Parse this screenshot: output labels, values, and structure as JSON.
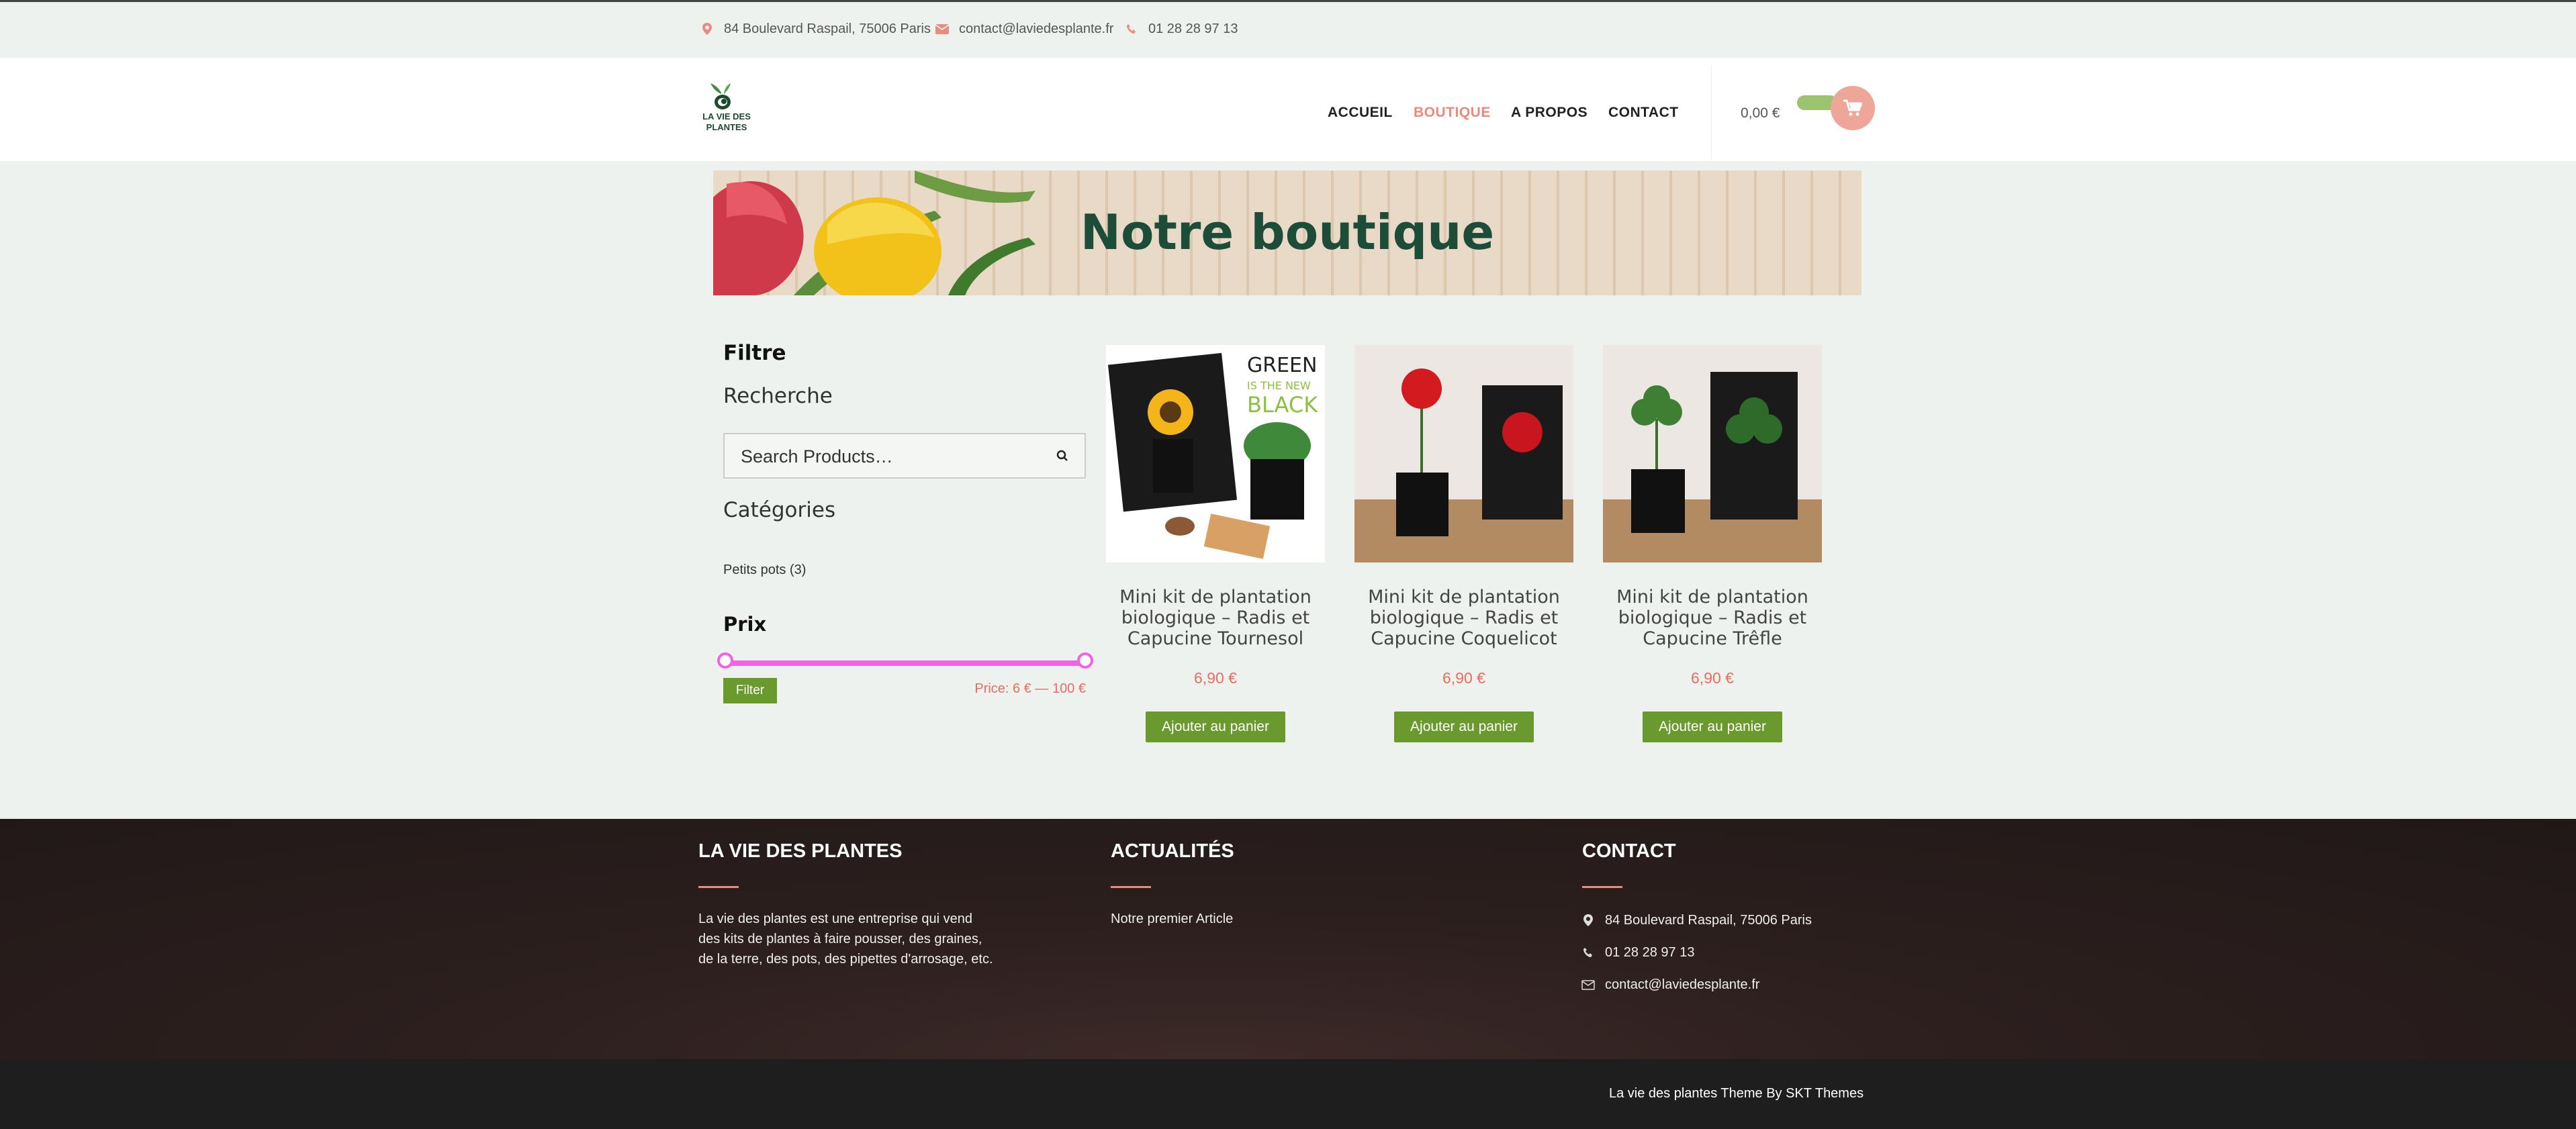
{
  "topbar": {
    "address": "84 Boulevard Raspail, 75006 Paris",
    "email": "contact@laviedesplante.fr",
    "phone": "01 28 28 97 13"
  },
  "logo": {
    "line1": "LA VIE DES",
    "line2": "PLANTES"
  },
  "nav": {
    "items": [
      "ACCUEIL",
      "BOUTIQUE",
      "A PROPOS",
      "CONTACT"
    ],
    "active": "BOUTIQUE"
  },
  "cart": {
    "total": "0,00 €",
    "icon": "cart-icon"
  },
  "banner": {
    "title": "Notre boutique"
  },
  "sidebar": {
    "filter_heading": "Filtre",
    "search_heading": "Recherche",
    "search_placeholder": "Search Products…",
    "categories_heading": "Catégories",
    "category_item": "Petits pots (3)",
    "price_heading": "Prix",
    "filter_button": "Filter",
    "price_range": "Price: 6 € — 100 €",
    "slider_min": 6,
    "slider_max": 100
  },
  "products": [
    {
      "title": "Mini kit de plantation biologique – Radis et Capucine Tournesol",
      "price": "6,90 €",
      "button": "Ajouter au panier",
      "image": "sunflower-kit"
    },
    {
      "title": "Mini kit de plantation biologique – Radis et Capucine Coquelicot",
      "price": "6,90 €",
      "button": "Ajouter au panier",
      "image": "poppy-kit"
    },
    {
      "title": "Mini kit de plantation biologique – Radis et Capucine Trêfle",
      "price": "6,90 €",
      "button": "Ajouter au panier",
      "image": "clover-kit"
    }
  ],
  "footer": {
    "col1": {
      "heading": "LA VIE DES PLANTES",
      "text": "La vie des plantes est une entreprise qui vend des kits de plantes à faire pousser, des graines, de la terre, des pots, des pipettes d'arrosage, etc."
    },
    "col2": {
      "heading": "ACTUALITÉS",
      "article": "Notre premier Article"
    },
    "col3": {
      "heading": "CONTACT",
      "address": "84 Boulevard Raspail, 75006 Paris",
      "phone": "01 28 28 97 13",
      "email": "contact@laviedesplante.fr"
    },
    "credit": "La vie des plantes Theme By SKT Themes"
  },
  "colors": {
    "accent": "#ea8a7d",
    "green": "#6a9a2d",
    "slider": "#f062e6",
    "title_green": "#1d4d39"
  }
}
